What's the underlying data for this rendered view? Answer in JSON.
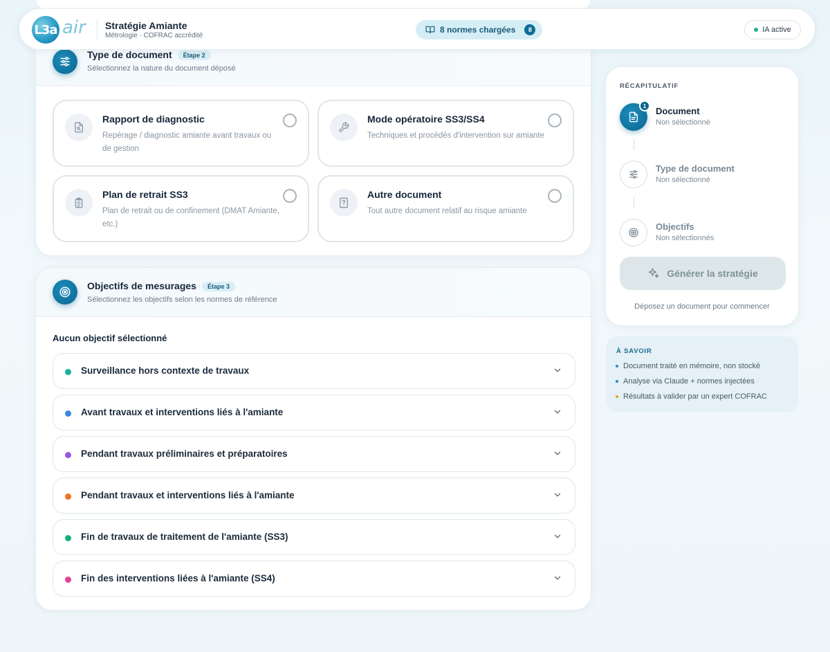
{
  "header": {
    "logo_text": "L3a",
    "logo_suffix": "air",
    "title": "Stratégie Amiante",
    "subtitle": "Métrologie · COFRAC accrédité",
    "norms_label": "8 normes chargées",
    "norms_count": "8",
    "ia_status": "IA active"
  },
  "doc_type": {
    "title": "Type de document",
    "badge": "Étape 2",
    "description": "Sélectionnez la nature du document déposé",
    "options": [
      {
        "title": "Rapport de diagnostic",
        "description": "Repérage / diagnostic amiante avant travaux ou de gestion",
        "icon": "file-search-icon"
      },
      {
        "title": "Mode opératoire SS3/SS4",
        "description": "Techniques et procédés d'intervention sur amiante",
        "icon": "wrench-icon"
      },
      {
        "title": "Plan de retrait SS3",
        "description": "Plan de retrait ou de confinement (DMAT Amiante, etc.)",
        "icon": "clipboard-icon"
      },
      {
        "title": "Autre document",
        "description": "Tout autre document relatif au risque amiante",
        "icon": "question-file-icon"
      }
    ]
  },
  "objectives": {
    "title": "Objectifs de mesurages",
    "badge": "Étape 3",
    "description": "Sélectionnez les objectifs selon les normes de référence",
    "status": "Aucun objectif sélectionné",
    "items": [
      {
        "label": "Surveillance hors contexte de travaux",
        "color": "#14b39a"
      },
      {
        "label": "Avant travaux et interventions liés à l'amiante",
        "color": "#3a86e0"
      },
      {
        "label": "Pendant travaux préliminaires et préparatoires",
        "color": "#9a55e0"
      },
      {
        "label": "Pendant travaux et interventions liés à l'amiante",
        "color": "#ee7020"
      },
      {
        "label": "Fin de travaux de traitement de l'amiante (SS3)",
        "color": "#17b07a"
      },
      {
        "label": "Fin des interventions liées à l'amiante (SS4)",
        "color": "#e83e96"
      }
    ]
  },
  "recap": {
    "label": "RÉCAPITULATIF",
    "steps": [
      {
        "title": "Document",
        "status": "Non sélectionné",
        "number": "1"
      },
      {
        "title": "Type de document",
        "status": "Non sélectionné"
      },
      {
        "title": "Objectifs",
        "status": "Non sélectionnés"
      }
    ],
    "generate_label": "Générer la stratégie",
    "hint": "Déposez un document pour commencer"
  },
  "savoir": {
    "title": "À SAVOIR",
    "items": [
      {
        "text": "Document traité en mémoire, non stocké",
        "color": "#2a8cc0"
      },
      {
        "text": "Analyse via Claude + normes injectées",
        "color": "#2a8cc0"
      },
      {
        "text": "Résultats à valider par un expert COFRAC",
        "color": "#f0a020"
      }
    ]
  }
}
